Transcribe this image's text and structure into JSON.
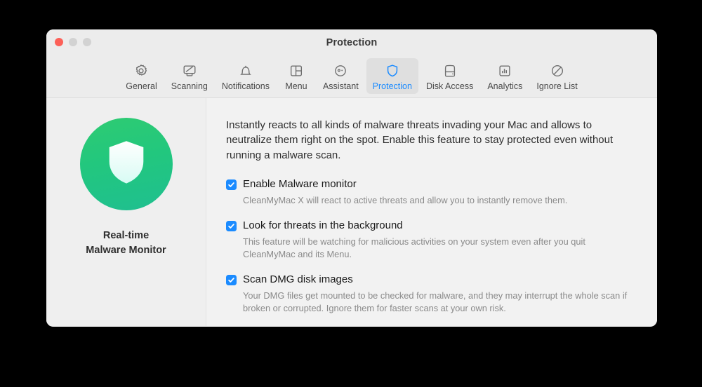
{
  "window": {
    "title": "Protection",
    "traffic_lights": [
      {
        "name": "close",
        "color": "#fc6058"
      },
      {
        "name": "minimize",
        "color": "#d2d2d2"
      },
      {
        "name": "zoom",
        "color": "#d2d2d2"
      }
    ]
  },
  "toolbar": {
    "selected": "Protection",
    "accent_color": "#1b8bff",
    "tabs": [
      {
        "label": "General",
        "icon": "gear-icon"
      },
      {
        "label": "Scanning",
        "icon": "monitor-scan-icon"
      },
      {
        "label": "Notifications",
        "icon": "bell-icon"
      },
      {
        "label": "Menu",
        "icon": "window-panes-icon"
      },
      {
        "label": "Assistant",
        "icon": "assistant-face-icon"
      },
      {
        "label": "Protection",
        "icon": "shield-icon"
      },
      {
        "label": "Disk Access",
        "icon": "hard-drive-icon"
      },
      {
        "label": "Analytics",
        "icon": "bar-chart-icon"
      },
      {
        "label": "Ignore List",
        "icon": "no-entry-icon"
      }
    ]
  },
  "sidebar": {
    "icon": "shield-badge-icon",
    "badge_color": "#25c97c",
    "title_line1": "Real-time",
    "title_line2": "Malware Monitor"
  },
  "content": {
    "intro": "Instantly reacts to all kinds of malware threats invading your Mac and allows to neutralize them right on the spot. Enable this feature to stay protected even without running a malware scan.",
    "options": [
      {
        "label": "Enable Malware monitor",
        "checked": true,
        "description": "CleanMyMac X will react to active threats and allow you to instantly remove them."
      },
      {
        "label": "Look for threats in the background",
        "checked": true,
        "description": "This feature will be watching for malicious activities on your system even after you quit CleanMyMac and its Menu."
      },
      {
        "label": "Scan DMG disk images",
        "checked": true,
        "description": "Your DMG files get mounted to be checked for malware, and they may interrupt the whole scan if broken or corrupted. Ignore them for faster scans at your own risk."
      }
    ]
  }
}
